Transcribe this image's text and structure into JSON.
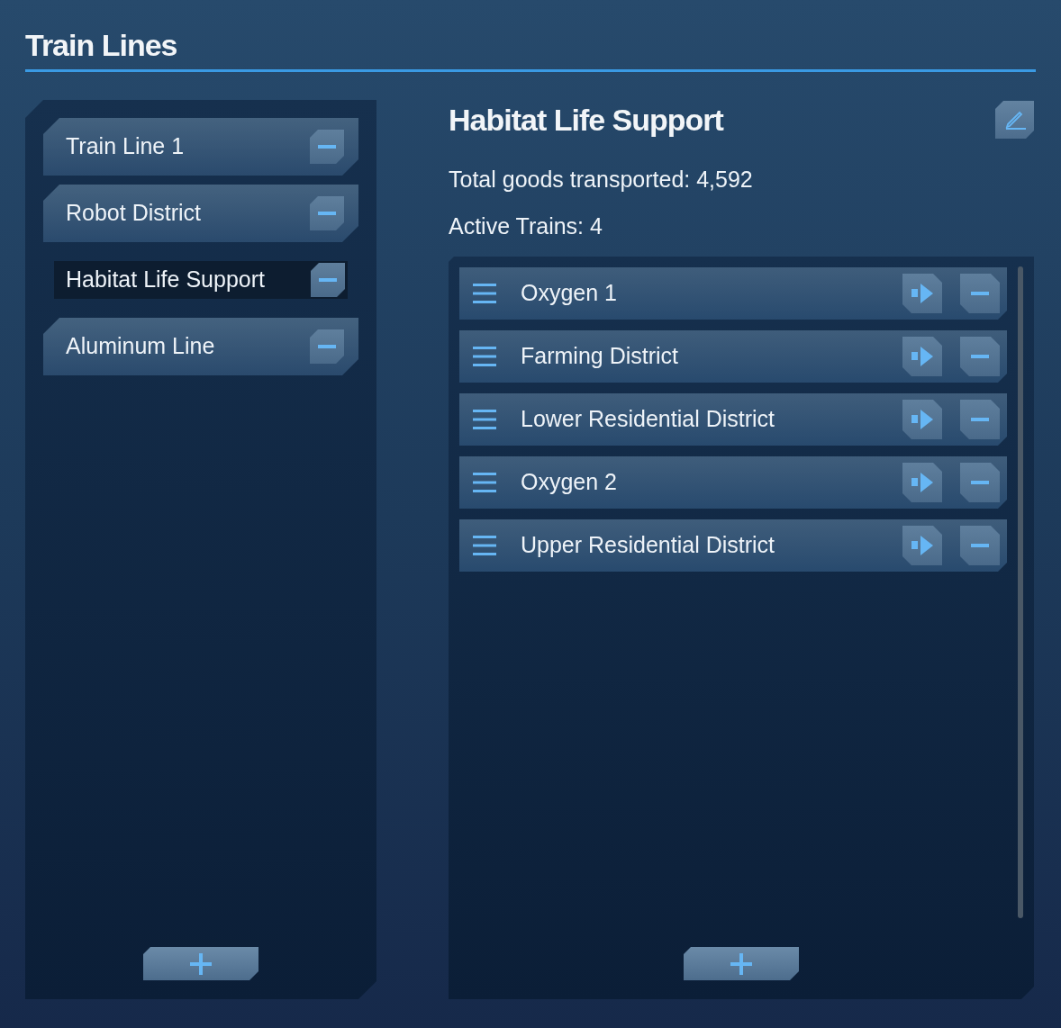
{
  "header": {
    "title": "Train Lines"
  },
  "lines": [
    {
      "name": "Train Line 1",
      "selected": false
    },
    {
      "name": "Robot District",
      "selected": false
    },
    {
      "name": "Habitat Life Support",
      "selected": true
    },
    {
      "name": "Aluminum Line",
      "selected": false
    }
  ],
  "detail": {
    "title": "Habitat Life Support",
    "stats": [
      "Total goods transported: 4,592",
      "Active Trains: 4"
    ],
    "stops": [
      {
        "name": "Oxygen 1"
      },
      {
        "name": "Farming District"
      },
      {
        "name": "Lower Residential District"
      },
      {
        "name": "Oxygen 2"
      },
      {
        "name": "Upper Residential District"
      }
    ]
  }
}
